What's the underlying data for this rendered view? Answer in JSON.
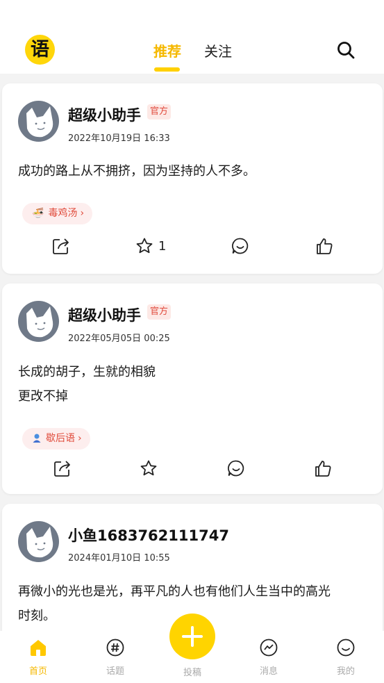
{
  "header": {
    "logo_text": "语",
    "tabs": [
      {
        "label": "推荐",
        "active": true
      },
      {
        "label": "关注",
        "active": false
      }
    ],
    "search_icon": "search-icon",
    "accent_color": "#ffd000"
  },
  "posts": [
    {
      "author": "超级小助手",
      "badge": "官方",
      "time": "2022年10月19日 16:33",
      "content": [
        "成功的路上从不拥挤，因为坚持的人不多。"
      ],
      "tag": {
        "label": "毒鸡汤",
        "icon": "noodle-bowl-icon"
      },
      "favorite_count": "1"
    },
    {
      "author": "超级小助手",
      "badge": "官方",
      "time": "2022年05月05日 00:25",
      "content": [
        "长成的胡子，生就的相貌",
        "更改不掉"
      ],
      "tag": {
        "label": "歇后语",
        "icon": "person-icon"
      },
      "favorite_count": ""
    },
    {
      "author": "小鱼1683762111747",
      "badge": "",
      "time": "2024年01月10日 10:55",
      "content": [
        "再微小的光也是光，再平凡的人也有他们人生当中的高光",
        "时刻。"
      ]
    }
  ],
  "nav": {
    "home": "首页",
    "topics": "话题",
    "post": "投稿",
    "messages": "消息",
    "mine": "我的"
  }
}
